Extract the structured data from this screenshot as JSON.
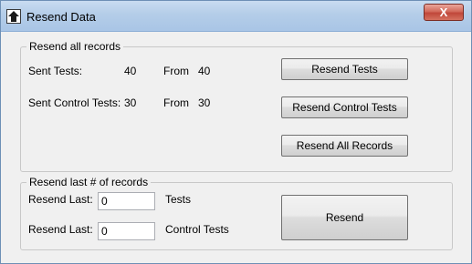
{
  "window": {
    "title": "Resend Data",
    "close_label": "X"
  },
  "group_all": {
    "legend": "Resend all records",
    "sent_tests_label": "Sent Tests:",
    "sent_tests_value": "40",
    "sent_tests_from_label": "From",
    "sent_tests_from_value": "40",
    "sent_control_label": "Sent Control Tests:",
    "sent_control_value": "30",
    "sent_control_from_label": "From",
    "sent_control_from_value": "30",
    "resend_tests_button": "Resend Tests",
    "resend_control_button": "Resend Control Tests",
    "resend_all_button": "Resend All Records"
  },
  "group_last": {
    "legend": "Resend  last # of records",
    "tests_row": {
      "label": "Resend Last:",
      "value": "0",
      "suffix": "Tests"
    },
    "control_row": {
      "label": "Resend Last:",
      "value": "0",
      "suffix": "Control Tests"
    },
    "resend_button": "Resend"
  }
}
